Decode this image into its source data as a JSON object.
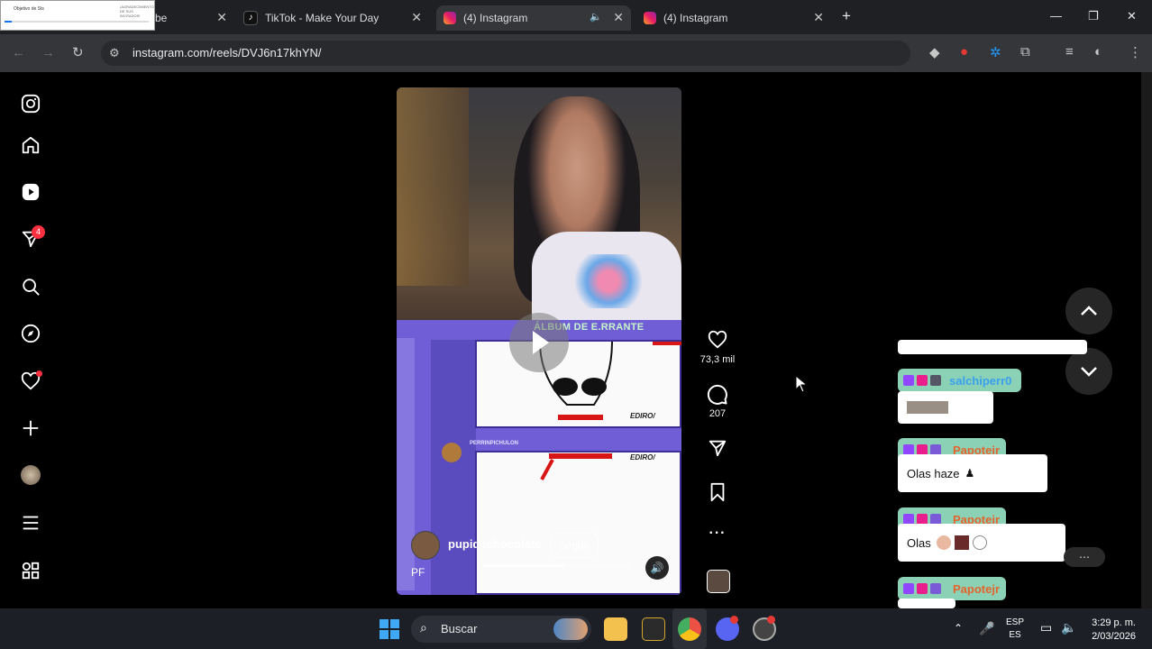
{
  "browser": {
    "tabs": [
      {
        "label": "be",
        "active": false
      },
      {
        "label": "TikTok - Make Your Day",
        "active": false
      },
      {
        "label": "(4) Instagram",
        "active": true
      },
      {
        "label": "(4) Instagram",
        "active": false
      }
    ],
    "thumbnail_popup": {
      "title": "Objetivo de Sts",
      "side_text": "¡AGRADECIMIENTO DE SUS INVITADOS!"
    },
    "url": "instagram.com/reels/DVJ6n17khYN/"
  },
  "sidebar": {
    "notifications_badge": "4",
    "items": [
      "instagram-logo",
      "home",
      "reels",
      "messages",
      "search",
      "explore",
      "notifications",
      "create",
      "profile",
      "more",
      "also-from-meta"
    ]
  },
  "reel": {
    "overlay_title": "ÁLBUM DE E.RRANTE",
    "stream_channel": "PERRINPICHULON",
    "canvas_text_1": "EDIRO/",
    "canvas_text_2": "EDIRO/",
    "author": "pupidechocolate",
    "follow_label": "Seguir",
    "caption_prefix": "PF",
    "progress": 0.55,
    "actions": {
      "likes": "73,3 mil",
      "comments": "207"
    }
  },
  "chat": {
    "messages": [
      {
        "user": "salchiperr0",
        "text": "",
        "user_color": "#3aa0f0"
      },
      {
        "user": "Papotejr",
        "text": "Olas haze",
        "user_color": "#e5642d"
      },
      {
        "user": "Papotejr",
        "text": "Olas",
        "user_color": "#e5642d"
      },
      {
        "user": "Papotejr",
        "text": "",
        "user_color": "#e5642d"
      }
    ]
  },
  "taskbar": {
    "search_placeholder": "Buscar",
    "lang_line1": "ESP",
    "lang_line2": "ES",
    "time": "3:29 p. m.",
    "date": "2/03/2026"
  }
}
